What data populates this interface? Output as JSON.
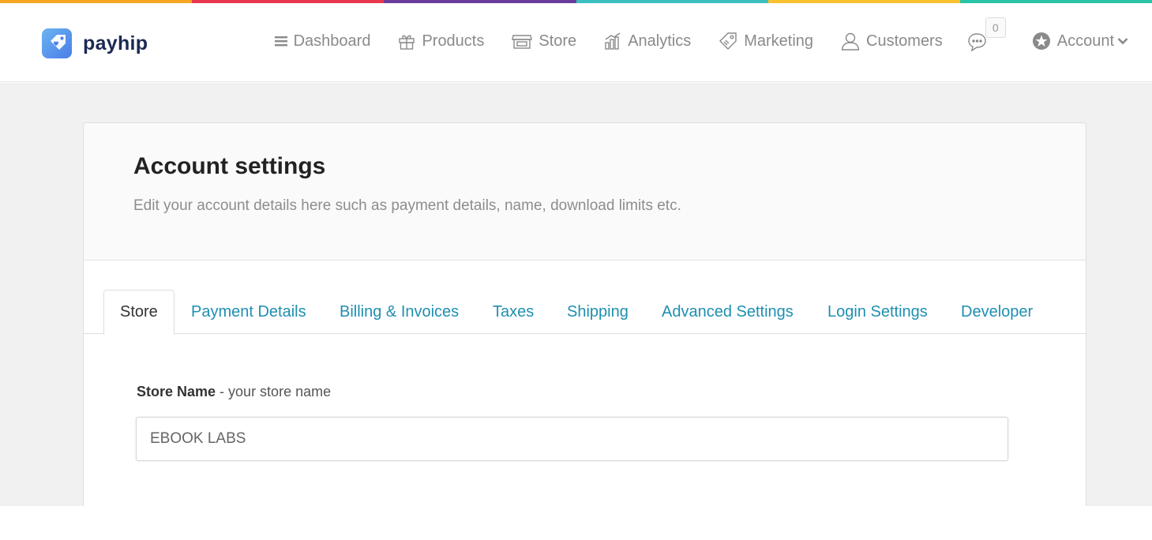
{
  "brand": {
    "name": "payhip",
    "rainbow_colors": [
      "#f5a623",
      "#e8384f",
      "#6a3d9a",
      "#3bbfbf",
      "#f9c02f",
      "#28c4a5"
    ]
  },
  "nav": {
    "items": [
      {
        "label": "Dashboard",
        "icon": "menu-icon"
      },
      {
        "label": "Products",
        "icon": "gift-icon"
      },
      {
        "label": "Store",
        "icon": "store-icon"
      },
      {
        "label": "Analytics",
        "icon": "analytics-icon"
      },
      {
        "label": "Marketing",
        "icon": "tag-icon"
      },
      {
        "label": "Customers",
        "icon": "user-icon"
      }
    ],
    "chat_count": "0",
    "account_label": "Account"
  },
  "page": {
    "title": "Account settings",
    "subtitle": "Edit your account details here such as payment details, name, download limits etc."
  },
  "tabs": [
    {
      "label": "Store",
      "active": true
    },
    {
      "label": "Payment Details"
    },
    {
      "label": "Billing & Invoices"
    },
    {
      "label": "Taxes"
    },
    {
      "label": "Shipping"
    },
    {
      "label": "Advanced Settings"
    },
    {
      "label": "Login Settings"
    },
    {
      "label": "Developer"
    }
  ],
  "form": {
    "store_name_label": "Store Name",
    "store_name_hint": " - your store name",
    "store_name_value": "EBOOK LABS"
  },
  "colors": {
    "accent": "#1f8fb0",
    "brand_dark": "#1b2a52"
  }
}
